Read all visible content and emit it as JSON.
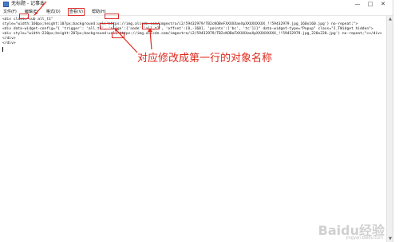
{
  "window": {
    "title": "无标题 - 记事本",
    "buttons": [
      "—",
      "□",
      "✕"
    ]
  },
  "menu": [
    "文件(F)",
    "编辑(E)",
    "格式(O)",
    "查看(V)",
    "帮助(H)"
  ],
  "editor": {
    "lines": [
      "<div class=\"sub all_t1\"",
      "style=\"width:160px;height:107px;background:url('https://img.alicdn.com/imgextra/i2/59432979/TB2cKOBeFXXXXXaeXpXXXXXXXXX_!!59432979.jpg_160x160.jpg') no-repeat;\">",
      "<div data-widget-config=\"{ 'trigger': 'all_t1', 'align':{'node':'all_t1', 'offset':[0,-160], 'points':['bc', 'tc']}}\" data-widget-type=\"Popup\" class=\"J_TWidget hidden\">",
      "<div style=\"width:220px;height:207px;background:url('https://img.alicdn.com/imgextra/i2/59432979/TB2cKOBeFXXXXXaeXpXXXXXXXXX_!!59432979.jpg_220x220.jpg') no-repeat;\"></div>",
      "</div>",
      "</div>"
    ]
  },
  "annotation": "对应修改成第一行的对象名称",
  "watermark": "Baidu经验",
  "watermark_sub": "jingyan.baidu.com",
  "colors": {
    "annotation": "#e0281b",
    "highlight_box": "#d62b2b"
  }
}
